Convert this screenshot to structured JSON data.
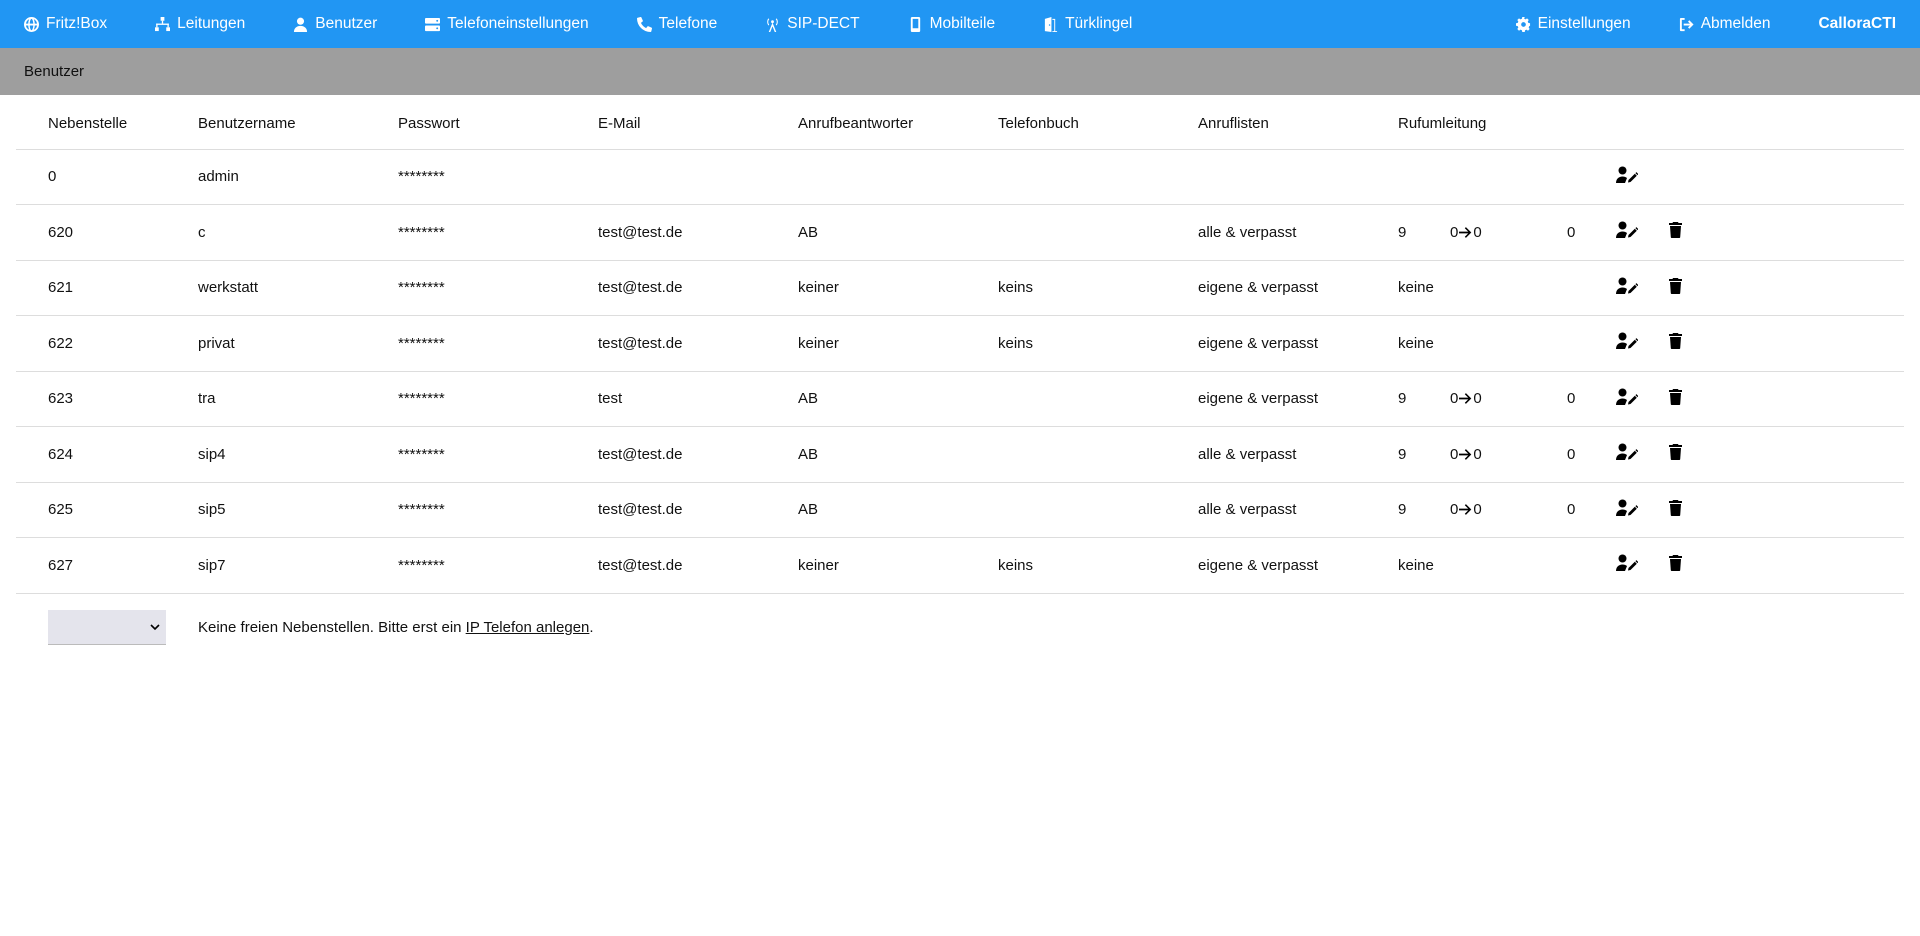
{
  "nav": {
    "items": [
      {
        "label": "Fritz!Box",
        "icon": "globe-icon"
      },
      {
        "label": "Leitungen",
        "icon": "network-icon"
      },
      {
        "label": "Benutzer",
        "icon": "user-icon"
      },
      {
        "label": "Telefoneinstellungen",
        "icon": "server-icon"
      },
      {
        "label": "Telefone",
        "icon": "phone-icon"
      },
      {
        "label": "SIP-DECT",
        "icon": "antenna-icon"
      },
      {
        "label": "Mobilteile",
        "icon": "mobile-icon"
      },
      {
        "label": "Türklingel",
        "icon": "door-icon"
      }
    ],
    "settings": {
      "label": "Einstellungen",
      "icon": "gear-icon"
    },
    "logout": {
      "label": "Abmelden",
      "icon": "logout-icon"
    },
    "brand": "CalloraCTI"
  },
  "subheader": {
    "title": "Benutzer"
  },
  "table": {
    "columns": [
      "Nebenstelle",
      "Benutzername",
      "Passwort",
      "E-Mail",
      "Anrufbeantworter",
      "Telefonbuch",
      "Anruflisten",
      "Rufumleitung"
    ],
    "rows": [
      {
        "ext": "0",
        "user": "admin",
        "pw": "********",
        "email": "",
        "ab": "",
        "book": "",
        "lists": "",
        "fwd_a": "",
        "fwd_b": "",
        "fwd_c": "",
        "fwd_text": "",
        "deletable": false
      },
      {
        "ext": "620",
        "user": "c",
        "pw": "********",
        "email": "test@test.de",
        "ab": "AB",
        "book": "",
        "lists": "alle & verpasst",
        "fwd_a": "9",
        "fwd_b1": "0",
        "fwd_b2": "0",
        "fwd_c": "0",
        "fwd_text": "",
        "deletable": true
      },
      {
        "ext": "621",
        "user": "werkstatt",
        "pw": "********",
        "email": "test@test.de",
        "ab": "keiner",
        "book": "keins",
        "lists": "eigene & verpasst",
        "fwd_text": "keine",
        "deletable": true
      },
      {
        "ext": "622",
        "user": "privat",
        "pw": "********",
        "email": "test@test.de",
        "ab": "keiner",
        "book": "keins",
        "lists": "eigene & verpasst",
        "fwd_text": "keine",
        "deletable": true
      },
      {
        "ext": "623",
        "user": "tra",
        "pw": "********",
        "email": "test",
        "ab": "AB",
        "book": "",
        "lists": "eigene & verpasst",
        "fwd_a": "9",
        "fwd_b1": "0",
        "fwd_b2": "0",
        "fwd_c": "0",
        "fwd_text": "",
        "deletable": true
      },
      {
        "ext": "624",
        "user": "sip4",
        "pw": "********",
        "email": "test@test.de",
        "ab": "AB",
        "book": "",
        "lists": "alle & verpasst",
        "fwd_a": "9",
        "fwd_b1": "0",
        "fwd_b2": "0",
        "fwd_c": "0",
        "fwd_text": "",
        "deletable": true
      },
      {
        "ext": "625",
        "user": "sip5",
        "pw": "********",
        "email": "test@test.de",
        "ab": "AB",
        "book": "",
        "lists": "alle & verpasst",
        "fwd_a": "9",
        "fwd_b1": "0",
        "fwd_b2": "0",
        "fwd_c": "0",
        "fwd_text": "",
        "deletable": true
      },
      {
        "ext": "627",
        "user": "sip7",
        "pw": "********",
        "email": "test@test.de",
        "ab": "keiner",
        "book": "keins",
        "lists": "eigene & verpasst",
        "fwd_text": "keine",
        "deletable": true
      }
    ]
  },
  "footer": {
    "select_value": "",
    "text_before": "Keine freien Nebenstellen. Bitte erst ein ",
    "link": "IP Telefon anlegen",
    "text_after": "."
  }
}
